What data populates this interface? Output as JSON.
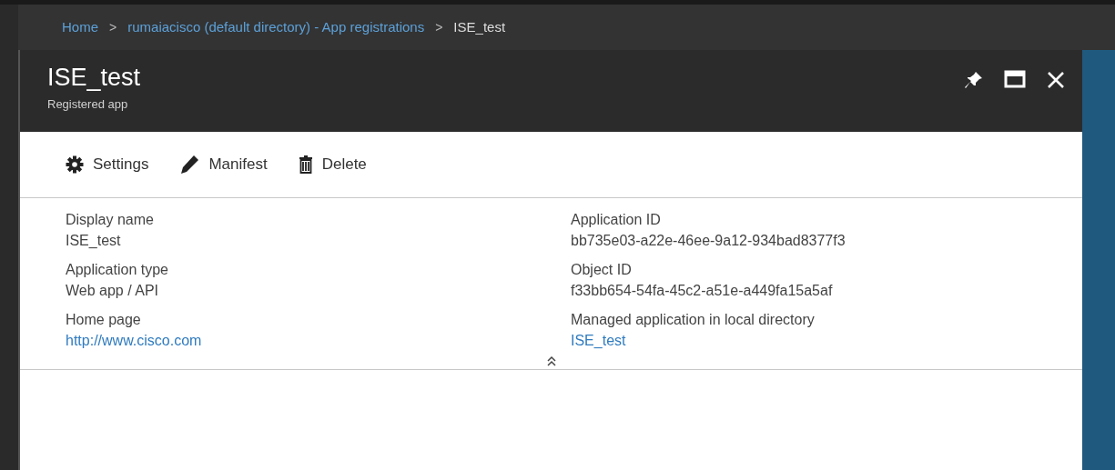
{
  "breadcrumb": [
    {
      "label": "Home",
      "kind": "link"
    },
    {
      "label": "rumaiacisco (default directory) - App registrations",
      "kind": "link"
    },
    {
      "label": "ISE_test",
      "kind": "current"
    }
  ],
  "breadcrumb_separator": ">",
  "blade": {
    "title": "ISE_test",
    "subtitle": "Registered app"
  },
  "toolbar": [
    {
      "label": "Settings",
      "kind": "settings"
    },
    {
      "label": "Manifest",
      "kind": "edit"
    },
    {
      "label": "Delete",
      "kind": "delete"
    }
  ],
  "fields": [
    {
      "label": "Display name",
      "value": "ISE_test",
      "kind": "text"
    },
    {
      "label": "Application ID",
      "value": "bb735e03-a22e-46ee-9a12-934bad8377f3",
      "kind": "text"
    },
    {
      "label": "Application type",
      "value": "Web app / API",
      "kind": "text"
    },
    {
      "label": "Object ID",
      "value": "f33bb654-54fa-45c2-a51e-a449fa15a5af",
      "kind": "text"
    },
    {
      "label": "Home page",
      "value": "http://www.cisco.com",
      "kind": "link"
    },
    {
      "label": "Managed application in local directory",
      "value": "ISE_test",
      "kind": "link"
    }
  ]
}
